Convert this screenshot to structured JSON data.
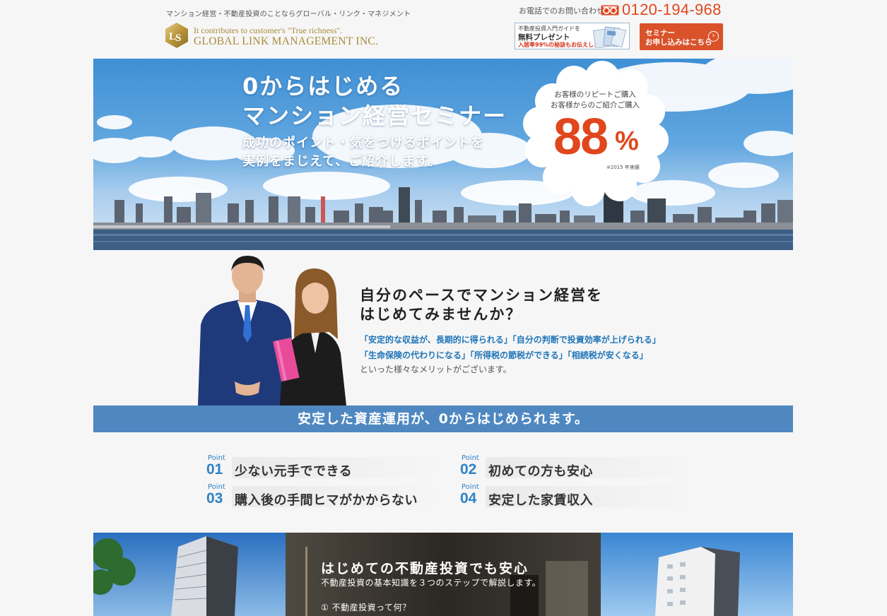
{
  "header": {
    "tagline": "マンション経営・不動産投資のことならグローバル・リンク・マネジメント",
    "logo": {
      "slogan": "It contributes to customer's \"True richness\".",
      "name": "GLOBAL LINK MANAGEMENT INC."
    },
    "phone_label": "お電話でのお問い合わせ",
    "phone_number": "0120-194-968",
    "guide_banner": {
      "title": "不動産投資入門ガイドを",
      "present": "無料プレゼント",
      "note": "入居率99%の秘訣もお伝えします"
    },
    "seminar_button": {
      "line1": "セミナー",
      "line2": "お申し込みはこちら"
    }
  },
  "hero": {
    "title_line1": "0からはじめる",
    "title_line2": "マンション経営セミナー",
    "sub_line1": "成功のポイント・気をつけるポイントを",
    "sub_line2": "実例をまじえて、ご紹介します。",
    "badge": {
      "line1": "お客様のリピートご購入",
      "line2": "お客様からのご紹介ご購入",
      "value": "88",
      "unit": "%",
      "note": "※2015 年実績"
    }
  },
  "intro": {
    "heading_line1": "自分のペースでマンション経営を",
    "heading_line2": "はじめてみませんか？",
    "merits_line1": "「安定的な収益が、長期的に得られる」「自分の判断で投資効率が上げられる」",
    "merits_line2": "「生命保険の代わりになる」「所得税の節税ができる」「相続税が安くなる」",
    "tail": "といった様々なメリットがございます。"
  },
  "band": {
    "text": "安定した資産運用が、0からはじめられます。"
  },
  "points": [
    {
      "label": "Point",
      "number": "01",
      "text": "少ない元手でできる"
    },
    {
      "label": "Point",
      "number": "02",
      "text": "初めての方も安心"
    },
    {
      "label": "Point",
      "number": "03",
      "text": "購入後の手間ヒマがかからない"
    },
    {
      "label": "Point",
      "number": "04",
      "text": "安定した家賃収入"
    }
  ],
  "bottom": {
    "title": "はじめての不動産投資でも安心",
    "subtitle": "不動産投資の基本知識を３つのステップで解説します。",
    "step1": "① 不動産投資って何？"
  },
  "colors": {
    "accent_orange": "#e0471d",
    "brand_gold": "#a88a3a",
    "band_blue": "#4f88c1",
    "point_blue": "#2f82c4"
  }
}
